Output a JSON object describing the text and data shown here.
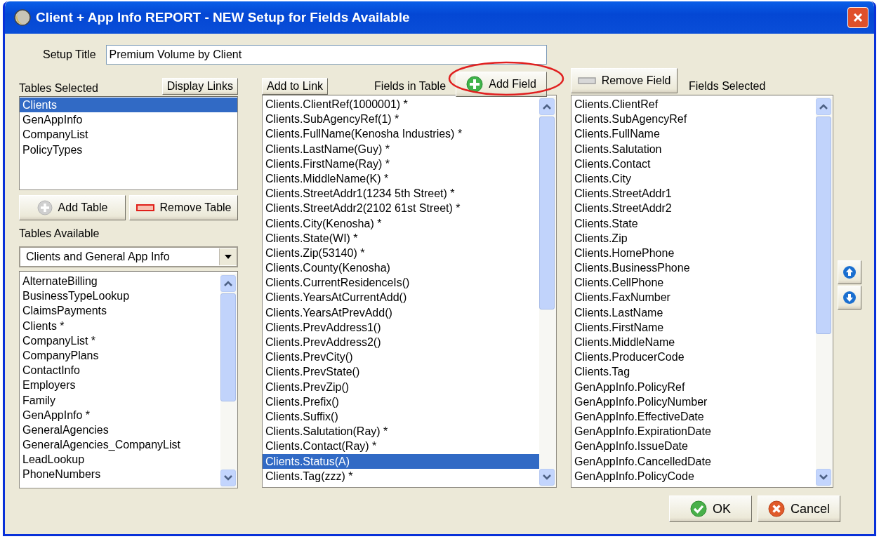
{
  "window": {
    "title": "Client + App Info REPORT - NEW Setup for Fields Available"
  },
  "setup_title": {
    "label": "Setup Title",
    "value": "Premium Volume by Client"
  },
  "tables_selected": {
    "label": "Tables Selected",
    "display_links_button": "Display Links",
    "items": [
      {
        "label": "Clients",
        "selected": true
      },
      {
        "label": "GenAppInfo",
        "selected": false
      },
      {
        "label": "CompanyList",
        "selected": false
      },
      {
        "label": "PolicyTypes",
        "selected": false
      }
    ]
  },
  "add_table_button": "Add Table",
  "remove_table_button": "Remove Table",
  "tables_available": {
    "label": "Tables Available",
    "dropdown": "Clients and General App Info",
    "items": [
      {
        "label": "AlternateBilling",
        "selected": false
      },
      {
        "label": "BusinessTypeLookup",
        "selected": false
      },
      {
        "label": "ClaimsPayments",
        "selected": false
      },
      {
        "label": "Clients *",
        "selected": false
      },
      {
        "label": "CompanyList *",
        "selected": false
      },
      {
        "label": "CompanyPlans",
        "selected": false
      },
      {
        "label": "ContactInfo",
        "selected": false
      },
      {
        "label": "Employers",
        "selected": false
      },
      {
        "label": "Family",
        "selected": false
      },
      {
        "label": "GenAppInfo *",
        "selected": false
      },
      {
        "label": "GeneralAgencies",
        "selected": false
      },
      {
        "label": "GeneralAgencies_CompanyList",
        "selected": false
      },
      {
        "label": "LeadLookup",
        "selected": false
      },
      {
        "label": "PhoneNumbers",
        "selected": false
      }
    ]
  },
  "fields_in_table": {
    "add_to_link_button": "Add to Link",
    "label": "Fields in Table",
    "add_field_button": "Add Field",
    "items": [
      {
        "label": "Clients.ClientRef(1000001) *",
        "selected": false
      },
      {
        "label": "Clients.SubAgencyRef(1) *",
        "selected": false
      },
      {
        "label": "Clients.FullName(Kenosha Industries) *",
        "selected": false
      },
      {
        "label": "Clients.LastName(Guy) *",
        "selected": false
      },
      {
        "label": "Clients.FirstName(Ray) *",
        "selected": false
      },
      {
        "label": "Clients.MiddleName(K) *",
        "selected": false
      },
      {
        "label": "Clients.StreetAddr1(1234 5th Street) *",
        "selected": false
      },
      {
        "label": "Clients.StreetAddr2(2102 61st Street) *",
        "selected": false
      },
      {
        "label": "Clients.City(Kenosha) *",
        "selected": false
      },
      {
        "label": "Clients.State(WI) *",
        "selected": false
      },
      {
        "label": "Clients.Zip(53140) *",
        "selected": false
      },
      {
        "label": "Clients.County(Kenosha)",
        "selected": false
      },
      {
        "label": "Clients.CurrentResidenceIs()",
        "selected": false
      },
      {
        "label": "Clients.YearsAtCurrentAdd()",
        "selected": false
      },
      {
        "label": "Clients.YearsAtPrevAdd()",
        "selected": false
      },
      {
        "label": "Clients.PrevAddress1()",
        "selected": false
      },
      {
        "label": "Clients.PrevAddress2()",
        "selected": false
      },
      {
        "label": "Clients.PrevCity()",
        "selected": false
      },
      {
        "label": "Clients.PrevState()",
        "selected": false
      },
      {
        "label": "Clients.PrevZip()",
        "selected": false
      },
      {
        "label": "Clients.Prefix()",
        "selected": false
      },
      {
        "label": "Clients.Suffix()",
        "selected": false
      },
      {
        "label": "Clients.Salutation(Ray) *",
        "selected": false
      },
      {
        "label": "Clients.Contact(Ray) *",
        "selected": false
      },
      {
        "label": "Clients.Status(A)",
        "selected": true
      },
      {
        "label": "Clients.Tag(zzz) *",
        "selected": false
      }
    ]
  },
  "fields_selected": {
    "remove_field_button": "Remove Field",
    "label": "Fields Selected",
    "items": [
      {
        "label": "Clients.ClientRef",
        "selected": false
      },
      {
        "label": "Clients.SubAgencyRef",
        "selected": false
      },
      {
        "label": "Clients.FullName",
        "selected": false
      },
      {
        "label": "Clients.Salutation",
        "selected": false
      },
      {
        "label": "Clients.Contact",
        "selected": false
      },
      {
        "label": "Clients.City",
        "selected": false
      },
      {
        "label": "Clients.StreetAddr1",
        "selected": false
      },
      {
        "label": "Clients.StreetAddr2",
        "selected": false
      },
      {
        "label": "Clients.State",
        "selected": false
      },
      {
        "label": "Clients.Zip",
        "selected": false
      },
      {
        "label": "Clients.HomePhone",
        "selected": false
      },
      {
        "label": "Clients.BusinessPhone",
        "selected": false
      },
      {
        "label": "Clients.CellPhone",
        "selected": false
      },
      {
        "label": "Clients.FaxNumber",
        "selected": false
      },
      {
        "label": "Clients.LastName",
        "selected": false
      },
      {
        "label": "Clients.FirstName",
        "selected": false
      },
      {
        "label": "Clients.MiddleName",
        "selected": false
      },
      {
        "label": "Clients.ProducerCode",
        "selected": false
      },
      {
        "label": "Clients.Tag",
        "selected": false
      },
      {
        "label": "GenAppInfo.PolicyRef",
        "selected": false
      },
      {
        "label": "GenAppInfo.PolicyNumber",
        "selected": false
      },
      {
        "label": "GenAppInfo.EffectiveDate",
        "selected": false
      },
      {
        "label": "GenAppInfo.ExpirationDate",
        "selected": false
      },
      {
        "label": "GenAppInfo.IssueDate",
        "selected": false
      },
      {
        "label": "GenAppInfo.CancelledDate",
        "selected": false
      },
      {
        "label": "GenAppInfo.PolicyCode",
        "selected": false
      }
    ]
  },
  "ok_button": "OK",
  "cancel_button": "Cancel"
}
